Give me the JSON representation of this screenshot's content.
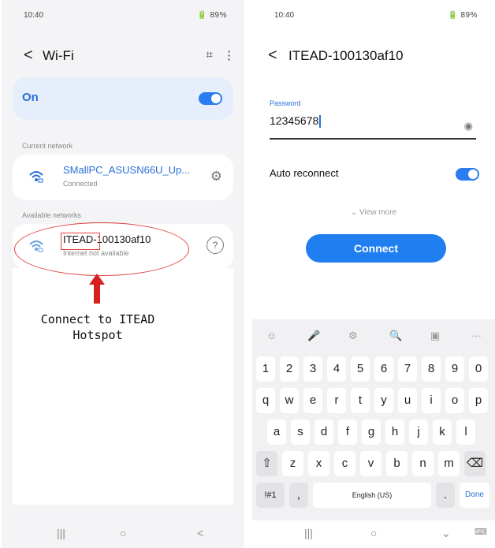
{
  "left": {
    "status": {
      "time": "10:40",
      "icons": "🔋 89%"
    },
    "title": "Wi-Fi",
    "on_label": "On",
    "current_network_label": "Current network",
    "current_network": {
      "name": "SMallPC_ASUSN66U_Up...",
      "status": "Connected"
    },
    "available_networks_label": "Available networks",
    "available_network": {
      "name_part1": "ITEAD",
      "name_part2": "-100130af10",
      "status": "Internet not available"
    },
    "annotation": {
      "line1": "Connect to ITEAD",
      "line2": "Hotspot"
    },
    "nav": {
      "recent": "|||",
      "home": "○",
      "back": "<"
    }
  },
  "right": {
    "status": {
      "time": "10:40",
      "icons": "🔋 89%"
    },
    "title": "ITEAD-100130af10",
    "password_label": "Password",
    "password_value": "12345678",
    "auto_reconnect_label": "Auto reconnect",
    "view_more_label": "⌄ View more",
    "connect_label": "Connect",
    "keyboard": {
      "suggestions": [
        "☺",
        "🎤",
        "⚙",
        "🔍",
        "▣",
        "···"
      ],
      "row1": [
        "1",
        "2",
        "3",
        "4",
        "5",
        "6",
        "7",
        "8",
        "9",
        "0"
      ],
      "row2": [
        "q",
        "w",
        "e",
        "r",
        "t",
        "y",
        "u",
        "i",
        "o",
        "p"
      ],
      "row3": [
        "a",
        "s",
        "d",
        "f",
        "g",
        "h",
        "j",
        "k",
        "l"
      ],
      "row4": [
        "⇧",
        "z",
        "x",
        "c",
        "v",
        "b",
        "n",
        "m",
        "⌫"
      ],
      "symbols_label": "!#1",
      "comma_label": ",",
      "space_label": "English (US)",
      "period_label": ".",
      "done_label": "Done"
    },
    "nav": {
      "recent": "|||",
      "home": "○",
      "back": "⌄",
      "kbd": "⌨"
    }
  },
  "colors": {
    "accent": "#2a6fd8",
    "annotation_red": "#d62020",
    "on_row_bg": "#e7eefb"
  }
}
